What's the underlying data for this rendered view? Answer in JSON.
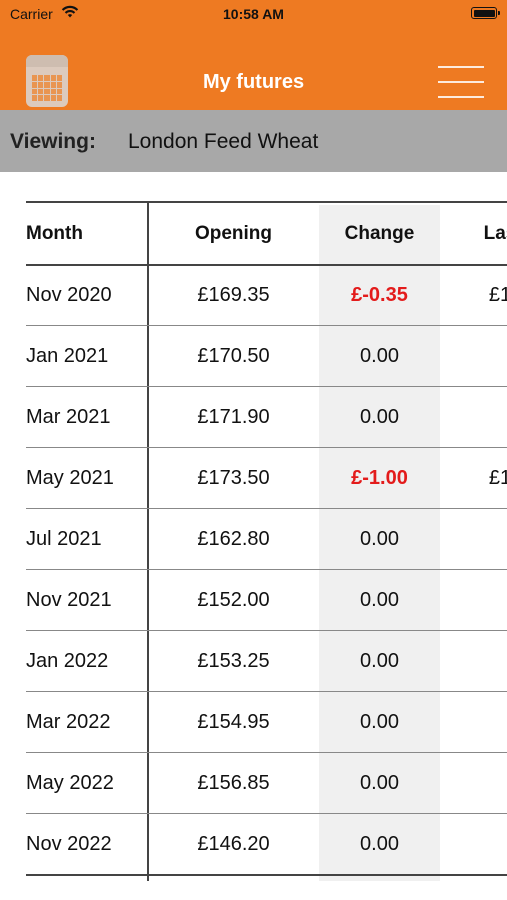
{
  "status_bar": {
    "carrier": "Carrier",
    "time": "10:58 AM"
  },
  "nav": {
    "title": "My futures"
  },
  "viewing": {
    "label": "Viewing:",
    "value": "London Feed Wheat"
  },
  "table": {
    "headers": {
      "month": "Month",
      "opening": "Opening",
      "change": "Change",
      "last": "Las"
    },
    "rows": [
      {
        "month": "Nov 2020",
        "opening": "£169.35",
        "change": "£-0.35",
        "last": "£1",
        "negative": true
      },
      {
        "month": "Jan 2021",
        "opening": "£170.50",
        "change": "0.00",
        "last": "",
        "negative": false
      },
      {
        "month": "Mar 2021",
        "opening": "£171.90",
        "change": "0.00",
        "last": "",
        "negative": false
      },
      {
        "month": "May 2021",
        "opening": "£173.50",
        "change": "£-1.00",
        "last": "£1",
        "negative": true
      },
      {
        "month": "Jul 2021",
        "opening": "£162.80",
        "change": "0.00",
        "last": "",
        "negative": false
      },
      {
        "month": "Nov 2021",
        "opening": "£152.00",
        "change": "0.00",
        "last": "",
        "negative": false
      },
      {
        "month": "Jan 2022",
        "opening": "£153.25",
        "change": "0.00",
        "last": "",
        "negative": false
      },
      {
        "month": "Mar 2022",
        "opening": "£154.95",
        "change": "0.00",
        "last": "",
        "negative": false
      },
      {
        "month": "May 2022",
        "opening": "£156.85",
        "change": "0.00",
        "last": "",
        "negative": false
      },
      {
        "month": "Nov 2022",
        "opening": "£146.20",
        "change": "0.00",
        "last": "",
        "negative": false
      }
    ]
  },
  "colors": {
    "nav_bg": "#ee7a22",
    "viewing_bg": "#a8a8a8",
    "negative_change": "#e31b1b"
  },
  "icons": {
    "calendar": "calendar-icon",
    "menu": "hamburger-menu-icon",
    "wifi": "wifi-icon",
    "battery": "battery-icon"
  }
}
